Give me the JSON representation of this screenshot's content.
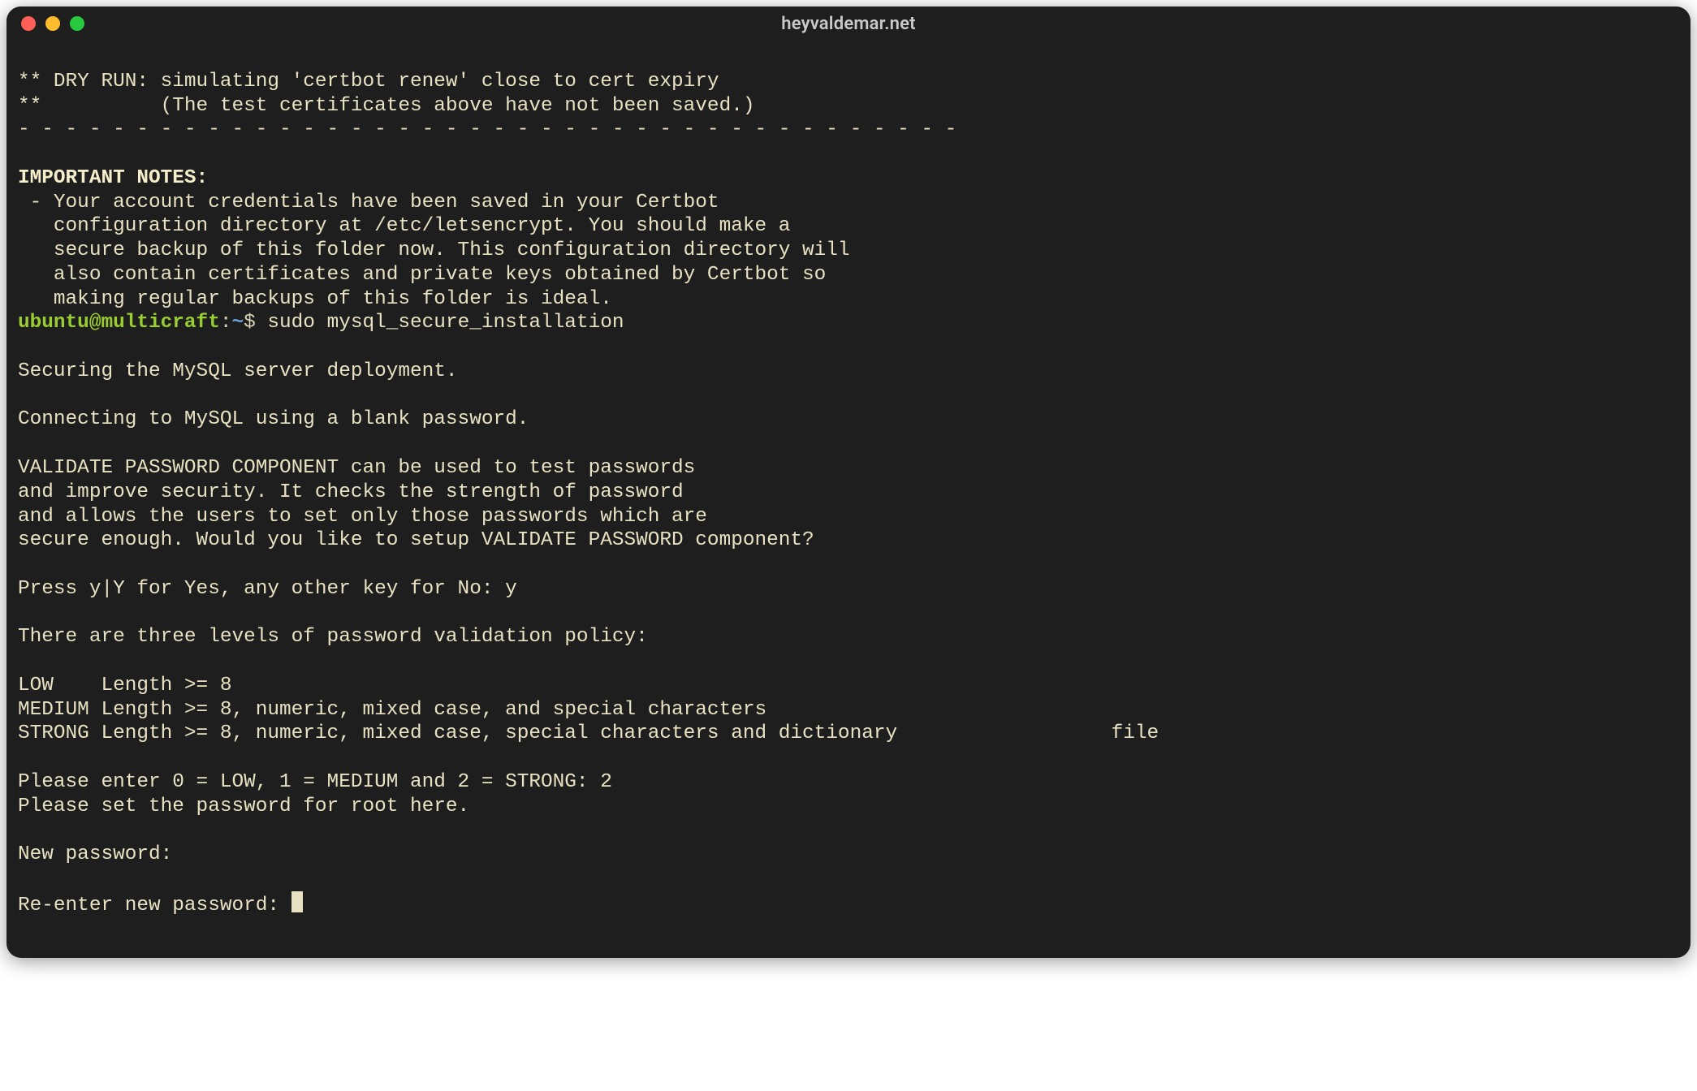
{
  "window": {
    "title": "heyvaldemar.net"
  },
  "colors": {
    "bg": "#1e1e1e",
    "fg": "#e8e2c2",
    "user": "#9acd32",
    "path": "#6aa0d8",
    "red": "#ff5f56",
    "yellow": "#ffbd2e",
    "green": "#27c93f"
  },
  "prompt": {
    "user_host": "ubuntu@multicraft",
    "colon": ":",
    "path": "~",
    "symbol": "$ ",
    "command": "sudo mysql_secure_installation"
  },
  "lines": {
    "l01": "** DRY RUN: simulating 'certbot renew' close to cert expiry",
    "l02": "**          (The test certificates above have not been saved.)",
    "l03": "- - - - - - - - - - - - - - - - - - - - - - - - - - - - - - - - - - - - - - - -",
    "l04": "",
    "l05": "IMPORTANT NOTES:",
    "l06": " - Your account credentials have been saved in your Certbot",
    "l07": "   configuration directory at /etc/letsencrypt. You should make a",
    "l08": "   secure backup of this folder now. This configuration directory will",
    "l09": "   also contain certificates and private keys obtained by Certbot so",
    "l10": "   making regular backups of this folder is ideal.",
    "l11": "",
    "l12": "Securing the MySQL server deployment.",
    "l13": "",
    "l14": "Connecting to MySQL using a blank password.",
    "l15": "",
    "l16": "VALIDATE PASSWORD COMPONENT can be used to test passwords",
    "l17": "and improve security. It checks the strength of password",
    "l18": "and allows the users to set only those passwords which are",
    "l19": "secure enough. Would you like to setup VALIDATE PASSWORD component?",
    "l20": "",
    "l21": "Press y|Y for Yes, any other key for No: y",
    "l22": "",
    "l23": "There are three levels of password validation policy:",
    "l24": "",
    "l25": "LOW    Length >= 8",
    "l26": "MEDIUM Length >= 8, numeric, mixed case, and special characters",
    "l27": "STRONG Length >= 8, numeric, mixed case, special characters and dictionary                  file",
    "l28": "",
    "l29": "Please enter 0 = LOW, 1 = MEDIUM and 2 = STRONG: 2",
    "l30": "Please set the password for root here.",
    "l31": "",
    "l32": "New password:",
    "l33": "",
    "l34": "Re-enter new password: "
  }
}
